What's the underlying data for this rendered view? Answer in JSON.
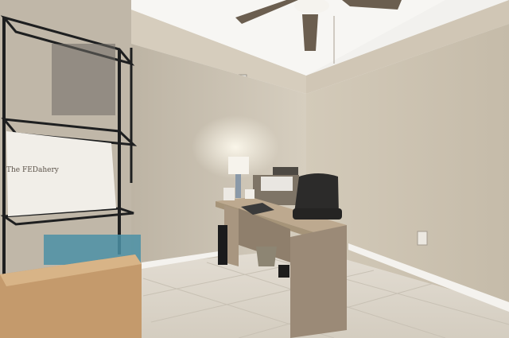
{
  "photo": {
    "box_print": "The FEDahery"
  },
  "colors": {
    "wall_left": "#cfc6b6",
    "wall_right": "#ccc2b1",
    "ceiling": "#f2f1ee",
    "tray_band": "#d6cdbd",
    "floor": "#dcd6cb",
    "baseboard": "#f4f2ee",
    "desk_top": "#bda98f",
    "desk_side": "#9b8a77",
    "chair": "#2c2b2a",
    "shelf_metal": "#1e1f20"
  }
}
